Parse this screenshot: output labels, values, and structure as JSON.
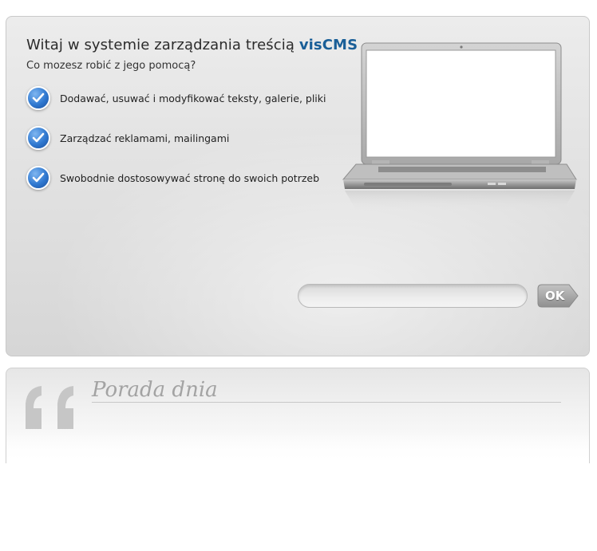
{
  "welcome": {
    "title_prefix": "Witaj w systemie zarządzania treścią ",
    "brand": "visCMS",
    "subtitle": "Co mozesz robić z jego pomocą?",
    "features": [
      {
        "label": "Dodawać, usuwać i modyfikować teksty, galerie, pliki",
        "icon": "checkmark-icon"
      },
      {
        "label": "Zarządzać reklamami, mailingami",
        "icon": "checkmark-icon"
      },
      {
        "label": "Swobodnie dostosowywać stronę do swoich potrzeb",
        "icon": "checkmark-icon"
      }
    ]
  },
  "form": {
    "input_value": "",
    "input_placeholder": "",
    "ok_label": "OK"
  },
  "tip": {
    "title": "Porada dnia",
    "icon": "quote-icon"
  },
  "colors": {
    "brand": "#1a5f98",
    "check_blue": "#2f78d0",
    "ok_button": "#9e9e9e"
  }
}
